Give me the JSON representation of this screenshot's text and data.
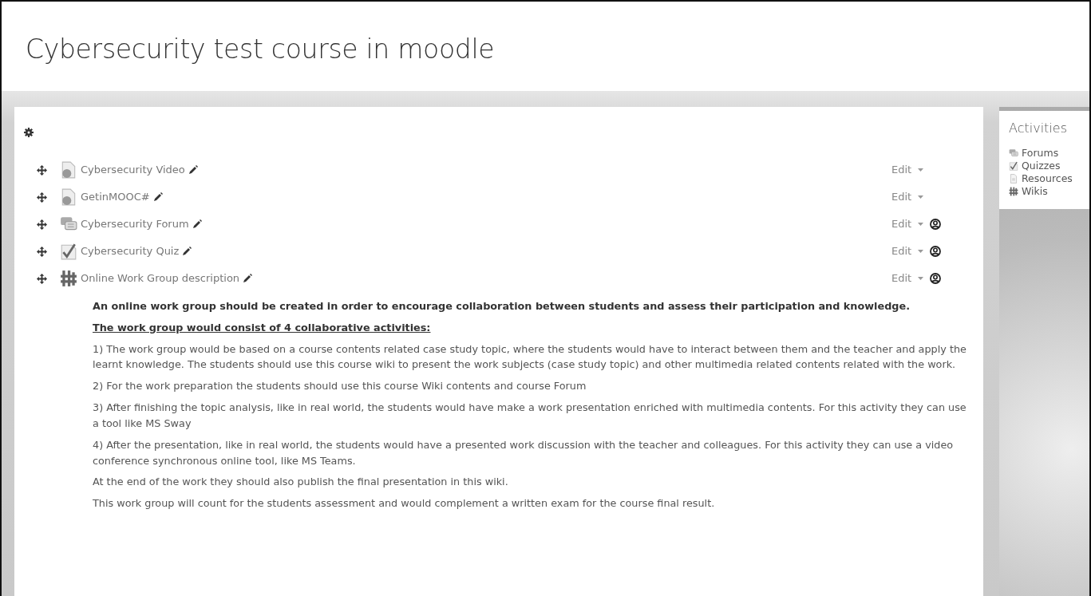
{
  "course_title": "Cybersecurity test course in moodle",
  "activities": [
    {
      "kind": "url",
      "name": "Cybersecurity Video",
      "edit": "Edit",
      "group_mode": false
    },
    {
      "kind": "url",
      "name": "GetinMOOC#",
      "edit": "Edit",
      "group_mode": false
    },
    {
      "kind": "forum",
      "name": "Cybersecurity Forum",
      "edit": "Edit",
      "group_mode": true
    },
    {
      "kind": "quiz",
      "name": "Cybersecurity Quiz",
      "edit": "Edit",
      "group_mode": true
    },
    {
      "kind": "wiki",
      "name": "Online Work Group description",
      "edit": "Edit",
      "group_mode": true
    }
  ],
  "description": [
    {
      "kind": "bold",
      "text": "An online work group should be created in order to encourage collaboration between students and assess their participation and knowledge."
    },
    {
      "kind": "heading",
      "text": "The work group would consist of 4 collaborative activities:"
    },
    {
      "kind": "plain",
      "text": "1) The work group would be based on a course contents related case study topic, where the students would have to interact between them and the teacher and apply the learnt knowledge. The students should use this course wiki to present the work subjects (case study topic) and other multimedia related contents related with the work."
    },
    {
      "kind": "plain",
      "text": "2) For the work preparation the students should use this course Wiki contents and course Forum"
    },
    {
      "kind": "plain",
      "text": "3) After finishing the topic analysis, like in real world, the students would have make a work presentation enriched with multimedia contents. For this activity they can use a tool like MS Sway"
    },
    {
      "kind": "plain",
      "text": "4) After the presentation, like in real world, the students would have a presented work discussion with the teacher and colleagues. For this activity they can use a video conference synchronous online tool, like MS Teams."
    },
    {
      "kind": "plain",
      "text": "At the end of the work they should also publish the final presentation in this wiki."
    },
    {
      "kind": "plain",
      "text": "This work group will count for the students assessment and would complement a written exam for the course final result."
    }
  ],
  "block": {
    "title": "Activities",
    "items": [
      {
        "kind": "forum",
        "label": "Forums"
      },
      {
        "kind": "quiz",
        "label": "Quizzes"
      },
      {
        "kind": "resource",
        "label": "Resources"
      },
      {
        "kind": "wiki",
        "label": "Wikis"
      }
    ]
  }
}
